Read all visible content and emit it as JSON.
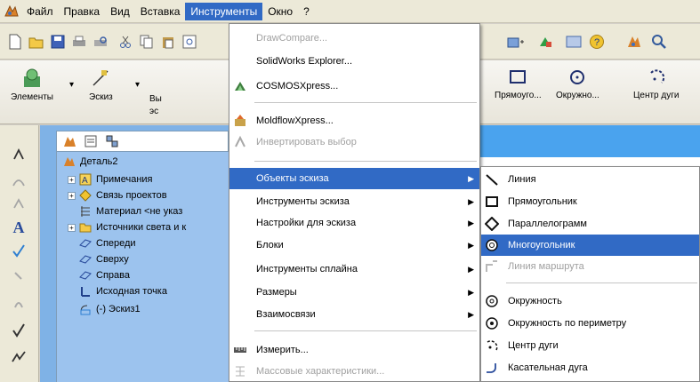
{
  "menubar": {
    "items": [
      "Файл",
      "Правка",
      "Вид",
      "Вставка",
      "Инструменты",
      "Окно",
      "?"
    ],
    "active_index": 4
  },
  "toolbar2": {
    "elements_label": "Элементы",
    "sketch_label": "Эскиз",
    "partial_label_1": "Вы",
    "partial_label_2": "эс",
    "rect_label": "Прямоуго...",
    "circle_label": "Окружно...",
    "arc_label": "Центр дуги"
  },
  "tree": {
    "items": [
      {
        "label": "Деталь2",
        "icon": "part-icon"
      },
      {
        "label": "Примечания",
        "icon": "annotations-icon"
      },
      {
        "label": "Связь проектов",
        "icon": "design-binder-icon"
      },
      {
        "label": "Материал <не указ",
        "icon": "material-icon"
      },
      {
        "label": "Источники света и к",
        "icon": "lights-folder-icon"
      },
      {
        "label": "Спереди",
        "icon": "plane-icon"
      },
      {
        "label": "Сверху",
        "icon": "plane-icon"
      },
      {
        "label": "Справа",
        "icon": "plane-icon"
      },
      {
        "label": "Исходная точка",
        "icon": "origin-icon"
      },
      {
        "label": "(-) Эскиз1",
        "icon": "sketch-icon"
      }
    ]
  },
  "tools_menu": {
    "items": [
      {
        "label": "DrawCompare...",
        "disabled": true,
        "icon": ""
      },
      {
        "label": "SolidWorks Explorer...",
        "disabled": false,
        "icon": ""
      },
      {
        "label": "COSMOSXpress...",
        "disabled": false,
        "icon": "cosmos-icon"
      },
      {
        "label": "MoldflowXpress...",
        "disabled": false,
        "icon": "moldflow-icon"
      },
      {
        "label": "Инвертировать выбор",
        "disabled": true,
        "icon": "invert-selection-icon"
      },
      {
        "label": "Объекты эскиза",
        "disabled": false,
        "icon": "",
        "submenu": true,
        "highlighted": true
      },
      {
        "label": "Инструменты эскиза",
        "disabled": false,
        "icon": "",
        "submenu": true
      },
      {
        "label": "Настройки для эскиза",
        "disabled": false,
        "icon": "",
        "submenu": true
      },
      {
        "label": "Блоки",
        "disabled": false,
        "icon": "",
        "submenu": true
      },
      {
        "label": "Инструменты сплайна",
        "disabled": false,
        "icon": "",
        "submenu": true
      },
      {
        "label": "Размеры",
        "disabled": false,
        "icon": "",
        "submenu": true
      },
      {
        "label": "Взаимосвязи",
        "disabled": false,
        "icon": "",
        "submenu": true
      },
      {
        "label": "Измерить...",
        "disabled": false,
        "icon": "measure-icon"
      },
      {
        "label": "Массовые характеристики...",
        "disabled": true,
        "icon": "mass-properties-icon"
      }
    ]
  },
  "sketch_entities_menu": {
    "items": [
      {
        "label": "Линия",
        "icon": "line-icon",
        "disabled": false
      },
      {
        "label": "Прямоугольник",
        "icon": "rectangle-icon",
        "disabled": false
      },
      {
        "label": "Параллелограмм",
        "icon": "parallelogram-icon",
        "disabled": false
      },
      {
        "label": "Многоугольник",
        "icon": "polygon-icon",
        "disabled": false,
        "highlighted": true
      },
      {
        "label": "Линия маршрута",
        "icon": "route-line-icon",
        "disabled": true
      },
      {
        "label": "Окружность",
        "icon": "circle-icon",
        "disabled": false
      },
      {
        "label": "Окружность по периметру",
        "icon": "perimeter-circle-icon",
        "disabled": false
      },
      {
        "label": "Центр дуги",
        "icon": "center-arc-icon",
        "disabled": false
      },
      {
        "label": "Касательная дуга",
        "icon": "tangent-arc-icon",
        "disabled": false
      }
    ]
  },
  "colors": {
    "highlight": "#316ac5",
    "tree_bg": "#9cc3ee",
    "band": "#4aa3ee"
  }
}
